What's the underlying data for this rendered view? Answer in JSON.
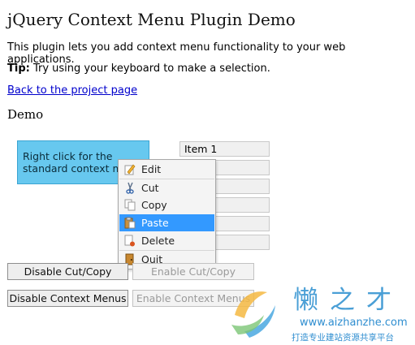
{
  "page": {
    "title": "jQuery Context Menu Plugin Demo",
    "intro": "This plugin lets you add context menu functionality to your web applications.",
    "tip_label": "Tip:",
    "tip_text": " Try using your keyboard to make a selection.",
    "back_link": "Back to the project page",
    "demo_heading": "Demo"
  },
  "demo": {
    "target_text": "Right click for the standard context m",
    "items": [
      "Item 1",
      "",
      "",
      "",
      "",
      ""
    ]
  },
  "context_menu": {
    "items": [
      {
        "label": "Edit",
        "icon": "edit-icon"
      },
      {
        "label": "Cut",
        "icon": "cut-icon"
      },
      {
        "label": "Copy",
        "icon": "copy-icon"
      },
      {
        "label": "Paste",
        "icon": "paste-icon",
        "active": true
      },
      {
        "label": "Delete",
        "icon": "delete-icon"
      },
      {
        "label": "Quit",
        "icon": "quit-icon"
      }
    ],
    "highlight_color": "#3399ff"
  },
  "buttons": {
    "disable_cut_copy": "Disable Cut/Copy",
    "enable_cut_copy": "Enable Cut/Copy",
    "disable_menus": "Disable Context Menus",
    "enable_menus": "Enable Context Menus"
  },
  "watermark": {
    "cn_title": "懒之才",
    "url": "www.aizhanzhe.com",
    "subtitle": "打造专业建站资源共享平台"
  }
}
